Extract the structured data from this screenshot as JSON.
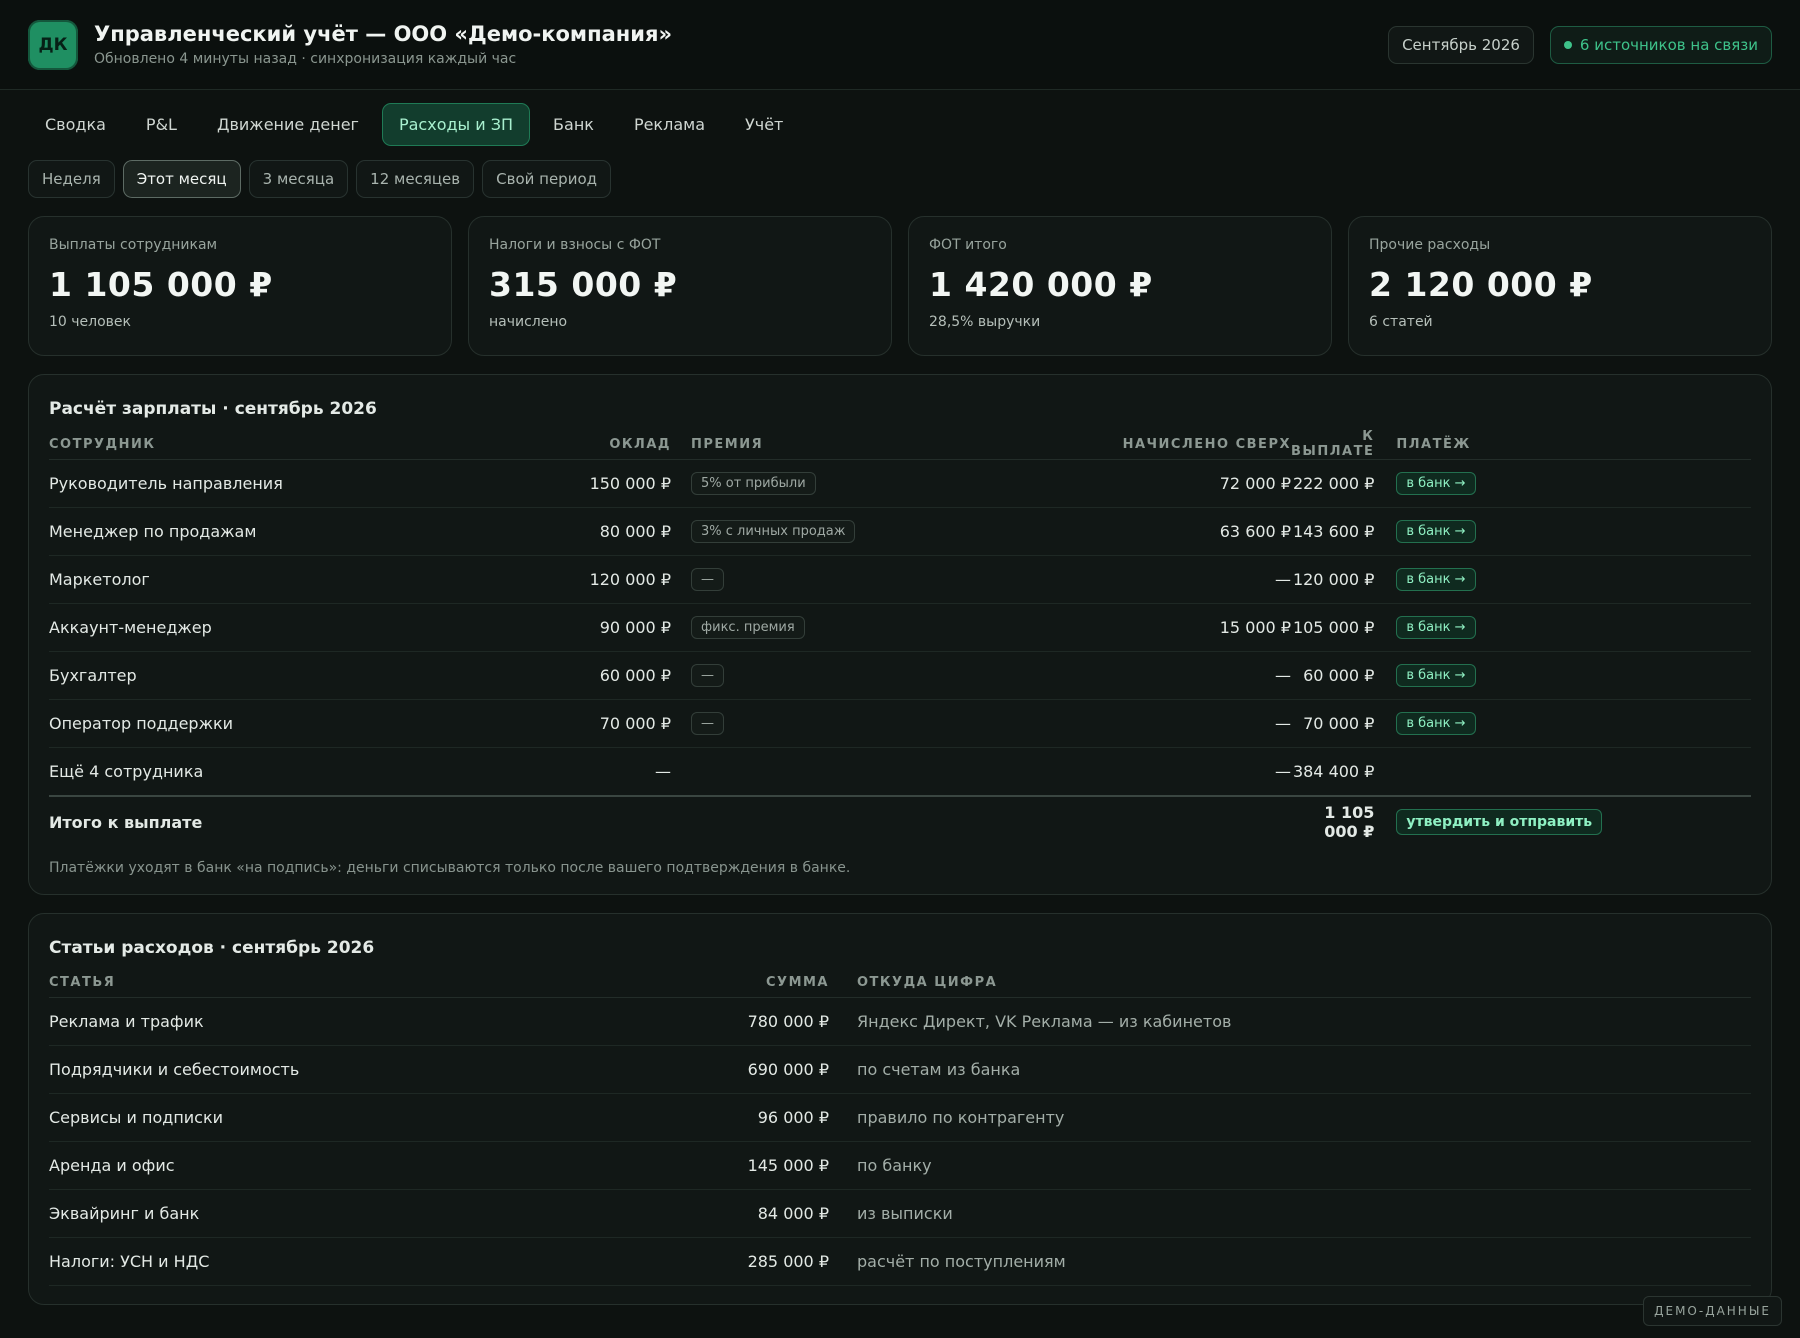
{
  "header": {
    "logo": "ДК",
    "title": "Управленческий учёт — ООО «Демо-компания»",
    "subtitle": "Обновлено 4 минуты назад · синхронизация каждый час",
    "period": "Сентябрь 2026",
    "status": "6 источников на связи"
  },
  "tabs": [
    "Сводка",
    "P&L",
    "Движение денег",
    "Расходы и ЗП",
    "Банк",
    "Реклама",
    "Учёт"
  ],
  "periods": [
    "Неделя",
    "Этот месяц",
    "3 месяца",
    "12 месяцев",
    "Свой период"
  ],
  "kpis": [
    {
      "label": "Выплаты сотрудникам",
      "value": "1 105 000 ₽",
      "sub": "10 человек"
    },
    {
      "label": "Налоги и взносы с ФОТ",
      "value": "315 000 ₽",
      "sub": "начислено"
    },
    {
      "label": "ФОТ итого",
      "value": "1 420 000 ₽",
      "sub": "28,5% выручки"
    },
    {
      "label": "Прочие расходы",
      "value": "2 120 000 ₽",
      "sub": "6 статей"
    }
  ],
  "payroll": {
    "title": "Расчёт зарплаты · сентябрь 2026",
    "headers": {
      "employee": "Сотрудник",
      "salary": "Оклад",
      "bonus": "Премия",
      "extra": "Начислено сверх",
      "payout": "К выплате",
      "payment": "Платёж"
    },
    "rows": [
      {
        "employee": "Руководитель направления",
        "salary": "150 000 ₽",
        "bonus": "5% от прибыли",
        "extra": "72 000 ₽",
        "payout": "222 000 ₽",
        "payment": "в банк →"
      },
      {
        "employee": "Менеджер по продажам",
        "salary": "80 000 ₽",
        "bonus": "3% с личных продаж",
        "extra": "63 600 ₽",
        "payout": "143 600 ₽",
        "payment": "в банк →"
      },
      {
        "employee": "Маркетолог",
        "salary": "120 000 ₽",
        "bonus": "—",
        "extra": "—",
        "payout": "120 000 ₽",
        "payment": "в банк →"
      },
      {
        "employee": "Аккаунт-менеджер",
        "salary": "90 000 ₽",
        "bonus": "фикс. премия",
        "extra": "15 000 ₽",
        "payout": "105 000 ₽",
        "payment": "в банк →"
      },
      {
        "employee": "Бухгалтер",
        "salary": "60 000 ₽",
        "bonus": "—",
        "extra": "—",
        "payout": "60 000 ₽",
        "payment": "в банк →"
      },
      {
        "employee": "Оператор поддержки",
        "salary": "70 000 ₽",
        "bonus": "—",
        "extra": "—",
        "payout": "70 000 ₽",
        "payment": "в банк →"
      }
    ],
    "more_row": {
      "employee": "Ещё 4 сотрудника",
      "salary": "—",
      "extra": "—",
      "payout": "384 400 ₽"
    },
    "total": {
      "label": "Итого к выплате",
      "payout": "1 105 000 ₽",
      "action": "утвердить и отправить"
    },
    "note": "Платёжки уходят в банк «на подпись»: деньги списываются только после вашего подтверждения в банке."
  },
  "expenses": {
    "title": "Статьи расходов · сентябрь 2026",
    "headers": {
      "item": "Статья",
      "amount": "Сумма",
      "source": "Откуда цифра"
    },
    "rows": [
      {
        "item": "Реклама и трафик",
        "amount": "780 000 ₽",
        "source": "Яндекс Директ, VK Реклама — из кабинетов"
      },
      {
        "item": "Подрядчики и себестоимость",
        "amount": "690 000 ₽",
        "source": "по счетам из банка"
      },
      {
        "item": "Сервисы и подписки",
        "amount": "96 000 ₽",
        "source": "правило по контрагенту"
      },
      {
        "item": "Аренда и офис",
        "amount": "145 000 ₽",
        "source": "по банку"
      },
      {
        "item": "Эквайринг и банк",
        "amount": "84 000 ₽",
        "source": "из выписки"
      },
      {
        "item": "Налоги: УСН и НДС",
        "amount": "285 000 ₽",
        "source": "расчёт по поступлениям"
      }
    ]
  },
  "demo_badge": "ДЕМО-ДАННЫЕ"
}
